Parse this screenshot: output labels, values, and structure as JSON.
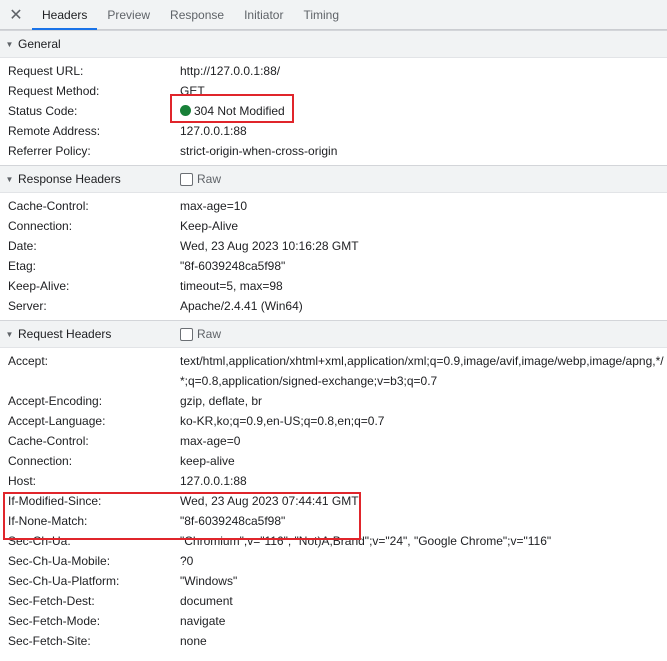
{
  "tabs": {
    "close_glyph": "✕",
    "items": [
      {
        "label": "Headers",
        "active": true
      },
      {
        "label": "Preview"
      },
      {
        "label": "Response"
      },
      {
        "label": "Initiator"
      },
      {
        "label": "Timing"
      }
    ]
  },
  "general": {
    "title": "General",
    "rows": [
      {
        "key": "Request URL:",
        "value": "http://127.0.0.1:88/"
      },
      {
        "key": "Request Method:",
        "value": "GET"
      },
      {
        "key": "Status Code:",
        "value": "304 Not Modified"
      },
      {
        "key": "Remote Address:",
        "value": "127.0.0.1:88"
      },
      {
        "key": "Referrer Policy:",
        "value": "strict-origin-when-cross-origin"
      }
    ]
  },
  "response_headers": {
    "title": "Response Headers",
    "raw_label": "Raw",
    "rows": [
      {
        "key": "Cache-Control:",
        "value": "max-age=10"
      },
      {
        "key": "Connection:",
        "value": "Keep-Alive"
      },
      {
        "key": "Date:",
        "value": "Wed, 23 Aug 2023 10:16:28 GMT"
      },
      {
        "key": "Etag:",
        "value": "\"8f-6039248ca5f98\""
      },
      {
        "key": "Keep-Alive:",
        "value": "timeout=5, max=98"
      },
      {
        "key": "Server:",
        "value": "Apache/2.4.41 (Win64)"
      }
    ]
  },
  "request_headers": {
    "title": "Request Headers",
    "raw_label": "Raw",
    "rows": [
      {
        "key": "Accept:",
        "value": "text/html,application/xhtml+xml,application/xml;q=0.9,image/avif,image/webp,image/apng,*/*;q=0.8,application/signed-exchange;v=b3;q=0.7"
      },
      {
        "key": "Accept-Encoding:",
        "value": "gzip, deflate, br"
      },
      {
        "key": "Accept-Language:",
        "value": "ko-KR,ko;q=0.9,en-US;q=0.8,en;q=0.7"
      },
      {
        "key": "Cache-Control:",
        "value": "max-age=0"
      },
      {
        "key": "Connection:",
        "value": "keep-alive"
      },
      {
        "key": "Host:",
        "value": "127.0.0.1:88"
      },
      {
        "key": "If-Modified-Since:",
        "value": "Wed, 23 Aug 2023 07:44:41 GMT"
      },
      {
        "key": "If-None-Match:",
        "value": "\"8f-6039248ca5f98\""
      },
      {
        "key": "Sec-Ch-Ua:",
        "value": "\"Chromium\";v=\"116\", \"Not)A;Brand\";v=\"24\", \"Google Chrome\";v=\"116\""
      },
      {
        "key": "Sec-Ch-Ua-Mobile:",
        "value": "?0"
      },
      {
        "key": "Sec-Ch-Ua-Platform:",
        "value": "\"Windows\""
      },
      {
        "key": "Sec-Fetch-Dest:",
        "value": "document"
      },
      {
        "key": "Sec-Fetch-Mode:",
        "value": "navigate"
      },
      {
        "key": "Sec-Fetch-Site:",
        "value": "none"
      }
    ]
  },
  "colors": {
    "status_ok": "#188038",
    "highlight_box": "#e0252b",
    "active_tab": "#1a73e8"
  }
}
